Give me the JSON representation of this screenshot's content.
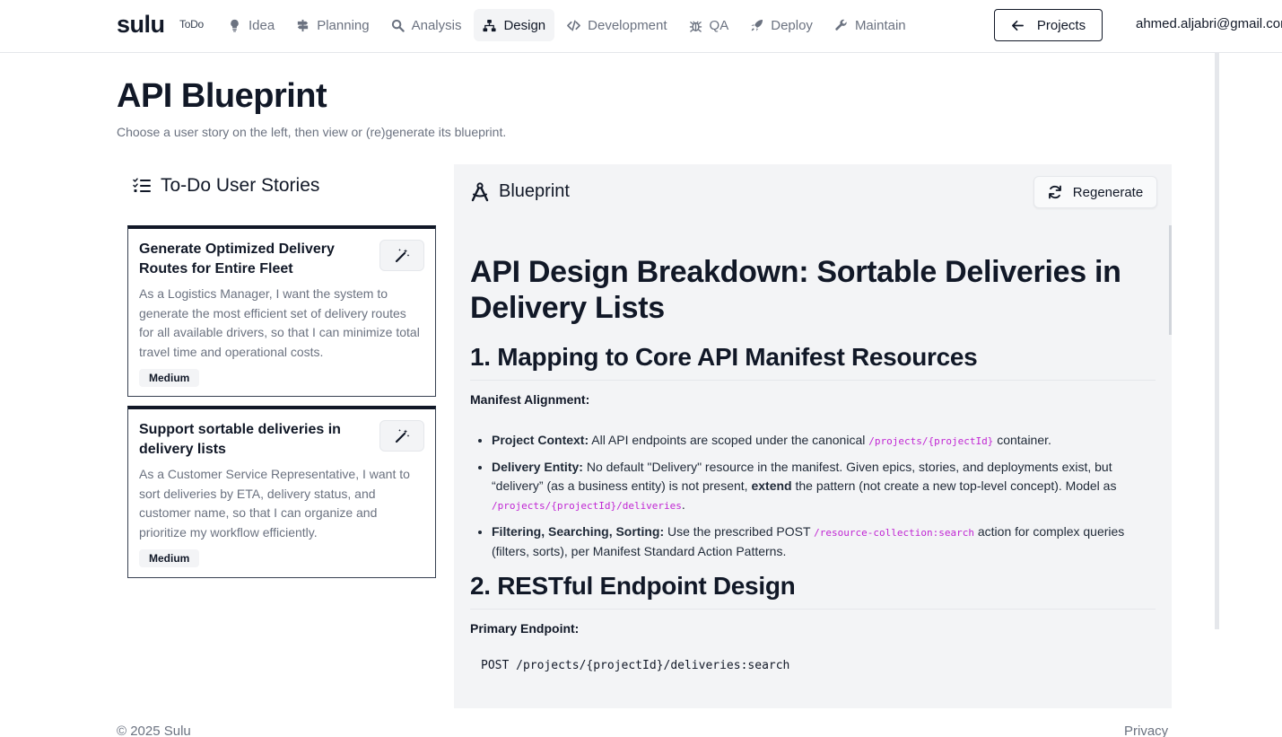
{
  "app": {
    "logo": "sulu",
    "todo_badge": "ToDo"
  },
  "nav": {
    "items": [
      {
        "label": "Idea",
        "icon": "lightbulb-icon",
        "active": false
      },
      {
        "label": "Planning",
        "icon": "signpost-icon",
        "active": false
      },
      {
        "label": "Analysis",
        "icon": "magnifier-icon",
        "active": false
      },
      {
        "label": "Design",
        "icon": "sitemap-icon",
        "active": true
      },
      {
        "label": "Development",
        "icon": "code-icon",
        "active": false
      },
      {
        "label": "QA",
        "icon": "bug-icon",
        "active": false
      },
      {
        "label": "Deploy",
        "icon": "rocket-icon",
        "active": false
      },
      {
        "label": "Maintain",
        "icon": "wrench-icon",
        "active": false
      }
    ],
    "projects_label": "Projects",
    "user_email": "ahmed.aljabri@gmail.com"
  },
  "header": {
    "title": "API Blueprint",
    "subtitle": "Choose a user story on the left, then view or (re)generate its blueprint."
  },
  "stories": {
    "heading": "To-Do User Stories",
    "items": [
      {
        "title": "Generate Optimized Delivery Routes for Entire Fleet",
        "description": "As a Logistics Manager, I want the system to generate the most efficient set of delivery routes for all available drivers, so that I can minimize total travel time and operational costs.",
        "priority": "Medium"
      },
      {
        "title": "Support sortable deliveries in delivery lists",
        "description": "As a Customer Service Representative, I want to sort deliveries by ETA, delivery status, and customer name, so that I can organize and prioritize my workflow efficiently.",
        "priority": "Medium"
      }
    ]
  },
  "blueprint": {
    "heading": "Blueprint",
    "regenerate_label": "Regenerate",
    "h1": "API Design Breakdown: Sortable Deliveries in Delivery Lists",
    "section1": {
      "title": "1. Mapping to Core API Manifest Resources",
      "lead": "Manifest Alignment:",
      "bullets": {
        "b1_label": "Project Context:",
        "b1_text": " All API endpoints are scoped under the canonical ",
        "b1_code": "/projects/{projectId}",
        "b1_tail": " container.",
        "b2_label": "Delivery Entity:",
        "b2_text": " No default \"Delivery\" resource in the manifest. Given epics, stories, and deployments exist, but “delivery” (as a business entity) is not present, ",
        "b2_strong": "extend",
        "b2_mid": " the pattern (not create a new top-level concept). Model as ",
        "b2_code": "/projects/{projectId}/deliveries",
        "b2_tail": ".",
        "b3_label": "Filtering, Searching, Sorting:",
        "b3_text": " Use the prescribed POST ",
        "b3_code": "/resource-collection:search",
        "b3_tail": " action for complex queries (filters, sorts), per Manifest Standard Action Patterns."
      }
    },
    "section2": {
      "title": "2. RESTful Endpoint Design",
      "lead": "Primary Endpoint:",
      "code": "POST /projects/{projectId}/deliveries:search"
    }
  },
  "footer": {
    "copyright": "© 2025 Sulu",
    "privacy": "Privacy"
  }
}
